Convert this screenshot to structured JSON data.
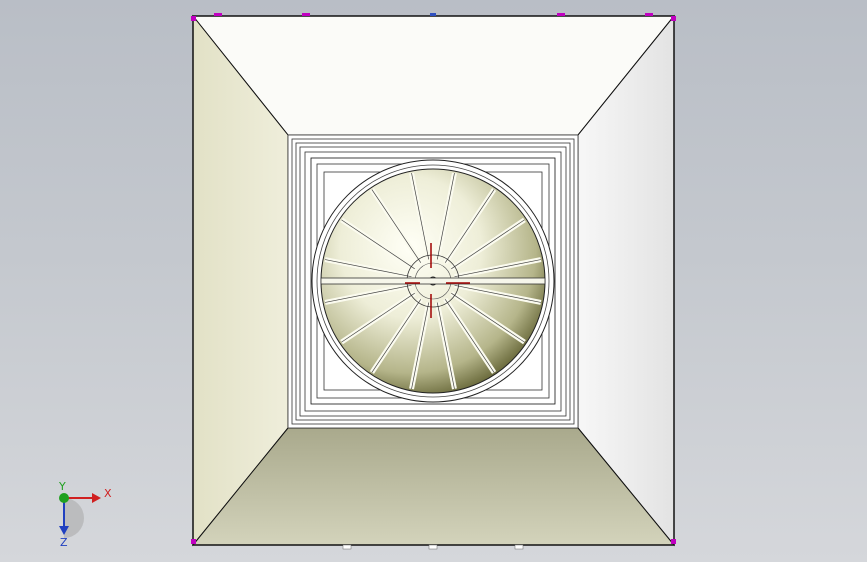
{
  "viewport": {
    "background_top": "#b9bec6",
    "background_bottom": "#d5d7db"
  },
  "model": {
    "outer_frame_color": "#111111",
    "top_wall_color": "#fbfbf8",
    "left_wall_color": "#e6e5cc",
    "right_wall_color": "#ececec",
    "bottom_wall_color": "#c9c9ae",
    "fan_blade_count": 16,
    "fan_hub_color": "#fffff0",
    "fan_shade_color": "#6e6e3c",
    "marker_color_primary": "#c000c0",
    "marker_color_secondary": "#3050c0",
    "center_mark_color": "#a00000"
  },
  "triad": {
    "x_label": "X",
    "y_label": "Y",
    "z_label": "Z",
    "x_color": "#d02020",
    "y_color": "#20a020",
    "z_color": "#2040c0"
  }
}
